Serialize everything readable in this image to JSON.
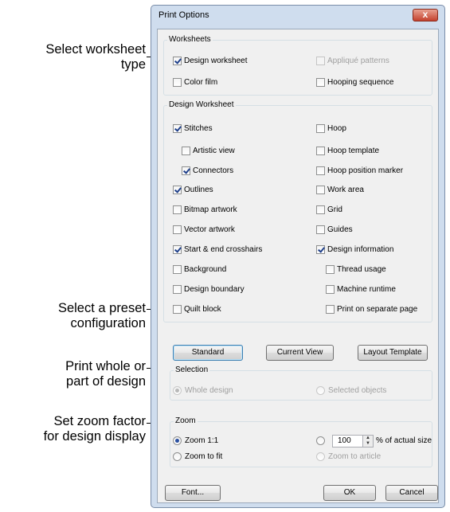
{
  "callouts": [
    {
      "lines": [
        "Select worksheet",
        "type"
      ]
    },
    {
      "lines": [
        "Select a preset",
        "configuration"
      ]
    },
    {
      "lines": [
        "Print whole or",
        "part of design"
      ]
    },
    {
      "lines": [
        "Set zoom factor",
        "for design display"
      ]
    }
  ],
  "dialog": {
    "title": "Print Options",
    "close_label": "x",
    "worksheets": {
      "label": "Worksheets",
      "items": [
        {
          "label": "Design worksheet",
          "checked": true
        },
        {
          "label": "Appliqué patterns",
          "checked": false,
          "disabled": true
        },
        {
          "label": "Color film",
          "checked": false
        },
        {
          "label": "Hooping sequence",
          "checked": false
        }
      ]
    },
    "design_worksheet": {
      "label": "Design Worksheet",
      "left": [
        {
          "label": "Stitches",
          "checked": true
        },
        {
          "label": "Artistic view",
          "checked": false
        },
        {
          "label": "Connectors",
          "checked": true
        },
        {
          "label": "Outlines",
          "checked": true
        },
        {
          "label": "Bitmap artwork",
          "checked": false
        },
        {
          "label": "Vector artwork",
          "checked": false
        },
        {
          "label": "Start & end crosshairs",
          "checked": true
        },
        {
          "label": "Background",
          "checked": false
        },
        {
          "label": "Design boundary",
          "checked": false
        },
        {
          "label": "Quilt block",
          "checked": false
        }
      ],
      "right": [
        {
          "label": "Hoop",
          "checked": false
        },
        {
          "label": "Hoop template",
          "checked": false
        },
        {
          "label": "Hoop position marker",
          "checked": false
        },
        {
          "label": "Work area",
          "checked": false
        },
        {
          "label": "Grid",
          "checked": false
        },
        {
          "label": "Guides",
          "checked": false
        },
        {
          "label": "Design information",
          "checked": true
        },
        {
          "label": "Thread usage",
          "checked": false
        },
        {
          "label": "Machine runtime",
          "checked": false
        },
        {
          "label": "Print on separate page",
          "checked": false
        }
      ]
    },
    "presets": {
      "standard": "Standard",
      "current_view": "Current View",
      "layout_template": "Layout Template"
    },
    "selection": {
      "label": "Selection",
      "whole_design": "Whole design",
      "selected_objects": "Selected objects",
      "selected": "whole_design"
    },
    "zoom": {
      "label": "Zoom",
      "zoom_1_1": "Zoom 1:1",
      "zoom_to_fit": "Zoom to fit",
      "zoom_to_article": "Zoom to article",
      "percent_value": "100",
      "percent_suffix": "% of actual size",
      "selected": "zoom_1_1"
    },
    "footer": {
      "font": "Font...",
      "ok": "OK",
      "cancel": "Cancel"
    }
  }
}
